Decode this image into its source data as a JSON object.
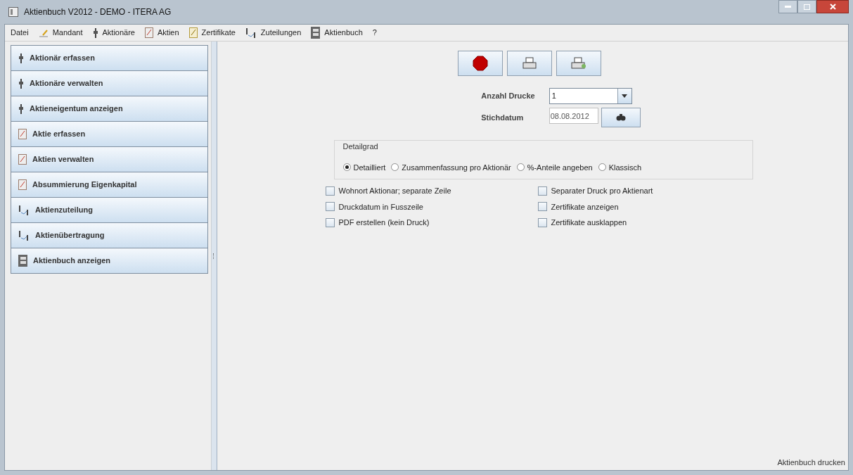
{
  "window": {
    "title": "Aktienbuch V2012 - DEMO - ITERA AG"
  },
  "menu": [
    {
      "label": "Datei",
      "kind": "plain"
    },
    {
      "label": "Mandant",
      "kind": "client"
    },
    {
      "label": "Aktionäre",
      "kind": "shareholder"
    },
    {
      "label": "Aktien",
      "kind": "share"
    },
    {
      "label": "Zertifikate",
      "kind": "certificate"
    },
    {
      "label": "Zuteilungen",
      "kind": "allocation"
    },
    {
      "label": "Aktienbuch",
      "kind": "register"
    },
    {
      "label": "?",
      "kind": "plain"
    }
  ],
  "sidebar": {
    "items": [
      {
        "label": "Aktionär erfassen",
        "kind": "shareholder"
      },
      {
        "label": "Aktionäre verwalten",
        "kind": "shareholder"
      },
      {
        "label": "Aktieneigentum anzeigen",
        "kind": "shareholder"
      },
      {
        "label": "Aktie erfassen",
        "kind": "share"
      },
      {
        "label": "Aktien verwalten",
        "kind": "share"
      },
      {
        "label": "Absummierung Eigenkapital",
        "kind": "share"
      },
      {
        "label": "Aktienzuteilung",
        "kind": "allocation"
      },
      {
        "label": "Aktienübertragung",
        "kind": "allocation"
      },
      {
        "label": "Aktienbuch anzeigen",
        "kind": "register"
      }
    ]
  },
  "toolbar": [
    {
      "kind": "cancel"
    },
    {
      "kind": "print"
    },
    {
      "kind": "preview"
    }
  ],
  "form": {
    "copies": {
      "label": "Anzahl Drucke",
      "value": "1"
    },
    "date": {
      "label": "Stichdatum",
      "value": "08.08.2012"
    }
  },
  "detail": {
    "title": "Detailgrad",
    "options": [
      {
        "label": "Detailliert",
        "selected": true
      },
      {
        "label": "Zusammenfassung pro Aktionär",
        "selected": false
      },
      {
        "label": "%-Anteile angeben",
        "selected": false
      },
      {
        "label": "Klassisch",
        "selected": false
      }
    ]
  },
  "options_left": [
    {
      "label": "Wohnort Aktionar; separate Zeile",
      "checked": false
    },
    {
      "label": "Druckdatum in Fusszeile",
      "checked": false
    },
    {
      "label": "PDF erstellen (kein Druck)",
      "checked": false
    }
  ],
  "options_right": [
    {
      "label": "Separater Druck pro Aktienart",
      "checked": false
    },
    {
      "label": "Zertifikate anzeigen",
      "checked": false
    },
    {
      "label": "Zertifikate ausklappen",
      "checked": false
    }
  ],
  "status_bar": "Aktienbuch drucken"
}
